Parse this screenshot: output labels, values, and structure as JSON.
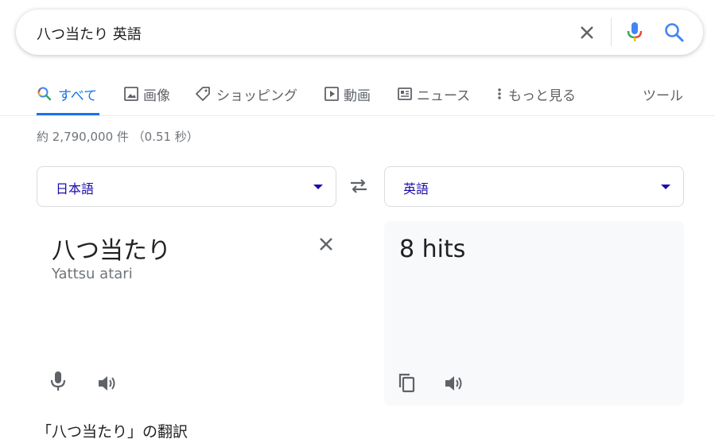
{
  "search": {
    "query": "八つ当たり 英語",
    "icons": {
      "clear": "close-icon",
      "voice": "mic-icon",
      "submit": "search-icon"
    }
  },
  "tabs": [
    {
      "label": "すべて",
      "icon": "search-icon",
      "active": true
    },
    {
      "label": "画像",
      "icon": "image-icon"
    },
    {
      "label": "ショッピング",
      "icon": "tag-icon"
    },
    {
      "label": "動画",
      "icon": "play-icon"
    },
    {
      "label": "ニュース",
      "icon": "news-icon"
    },
    {
      "label": "もっと見る",
      "icon": "more-vert-icon"
    }
  ],
  "tools_label": "ツール",
  "result_stats": "約 2,790,000 件 （0.51 秒）",
  "translate": {
    "source_lang": "日本語",
    "target_lang": "英語",
    "source_text": "八つ当たり",
    "source_romanization": "Yattsu atari",
    "target_text": "8 hits"
  },
  "translations_heading": "「八つ当たり」の翻訳",
  "colors": {
    "accent_blue": "#1a73e8",
    "link_blue": "#1a0dab",
    "gray_text": "#70757a",
    "icon_gray": "#5f6368",
    "target_bg": "#f8f9fa"
  }
}
